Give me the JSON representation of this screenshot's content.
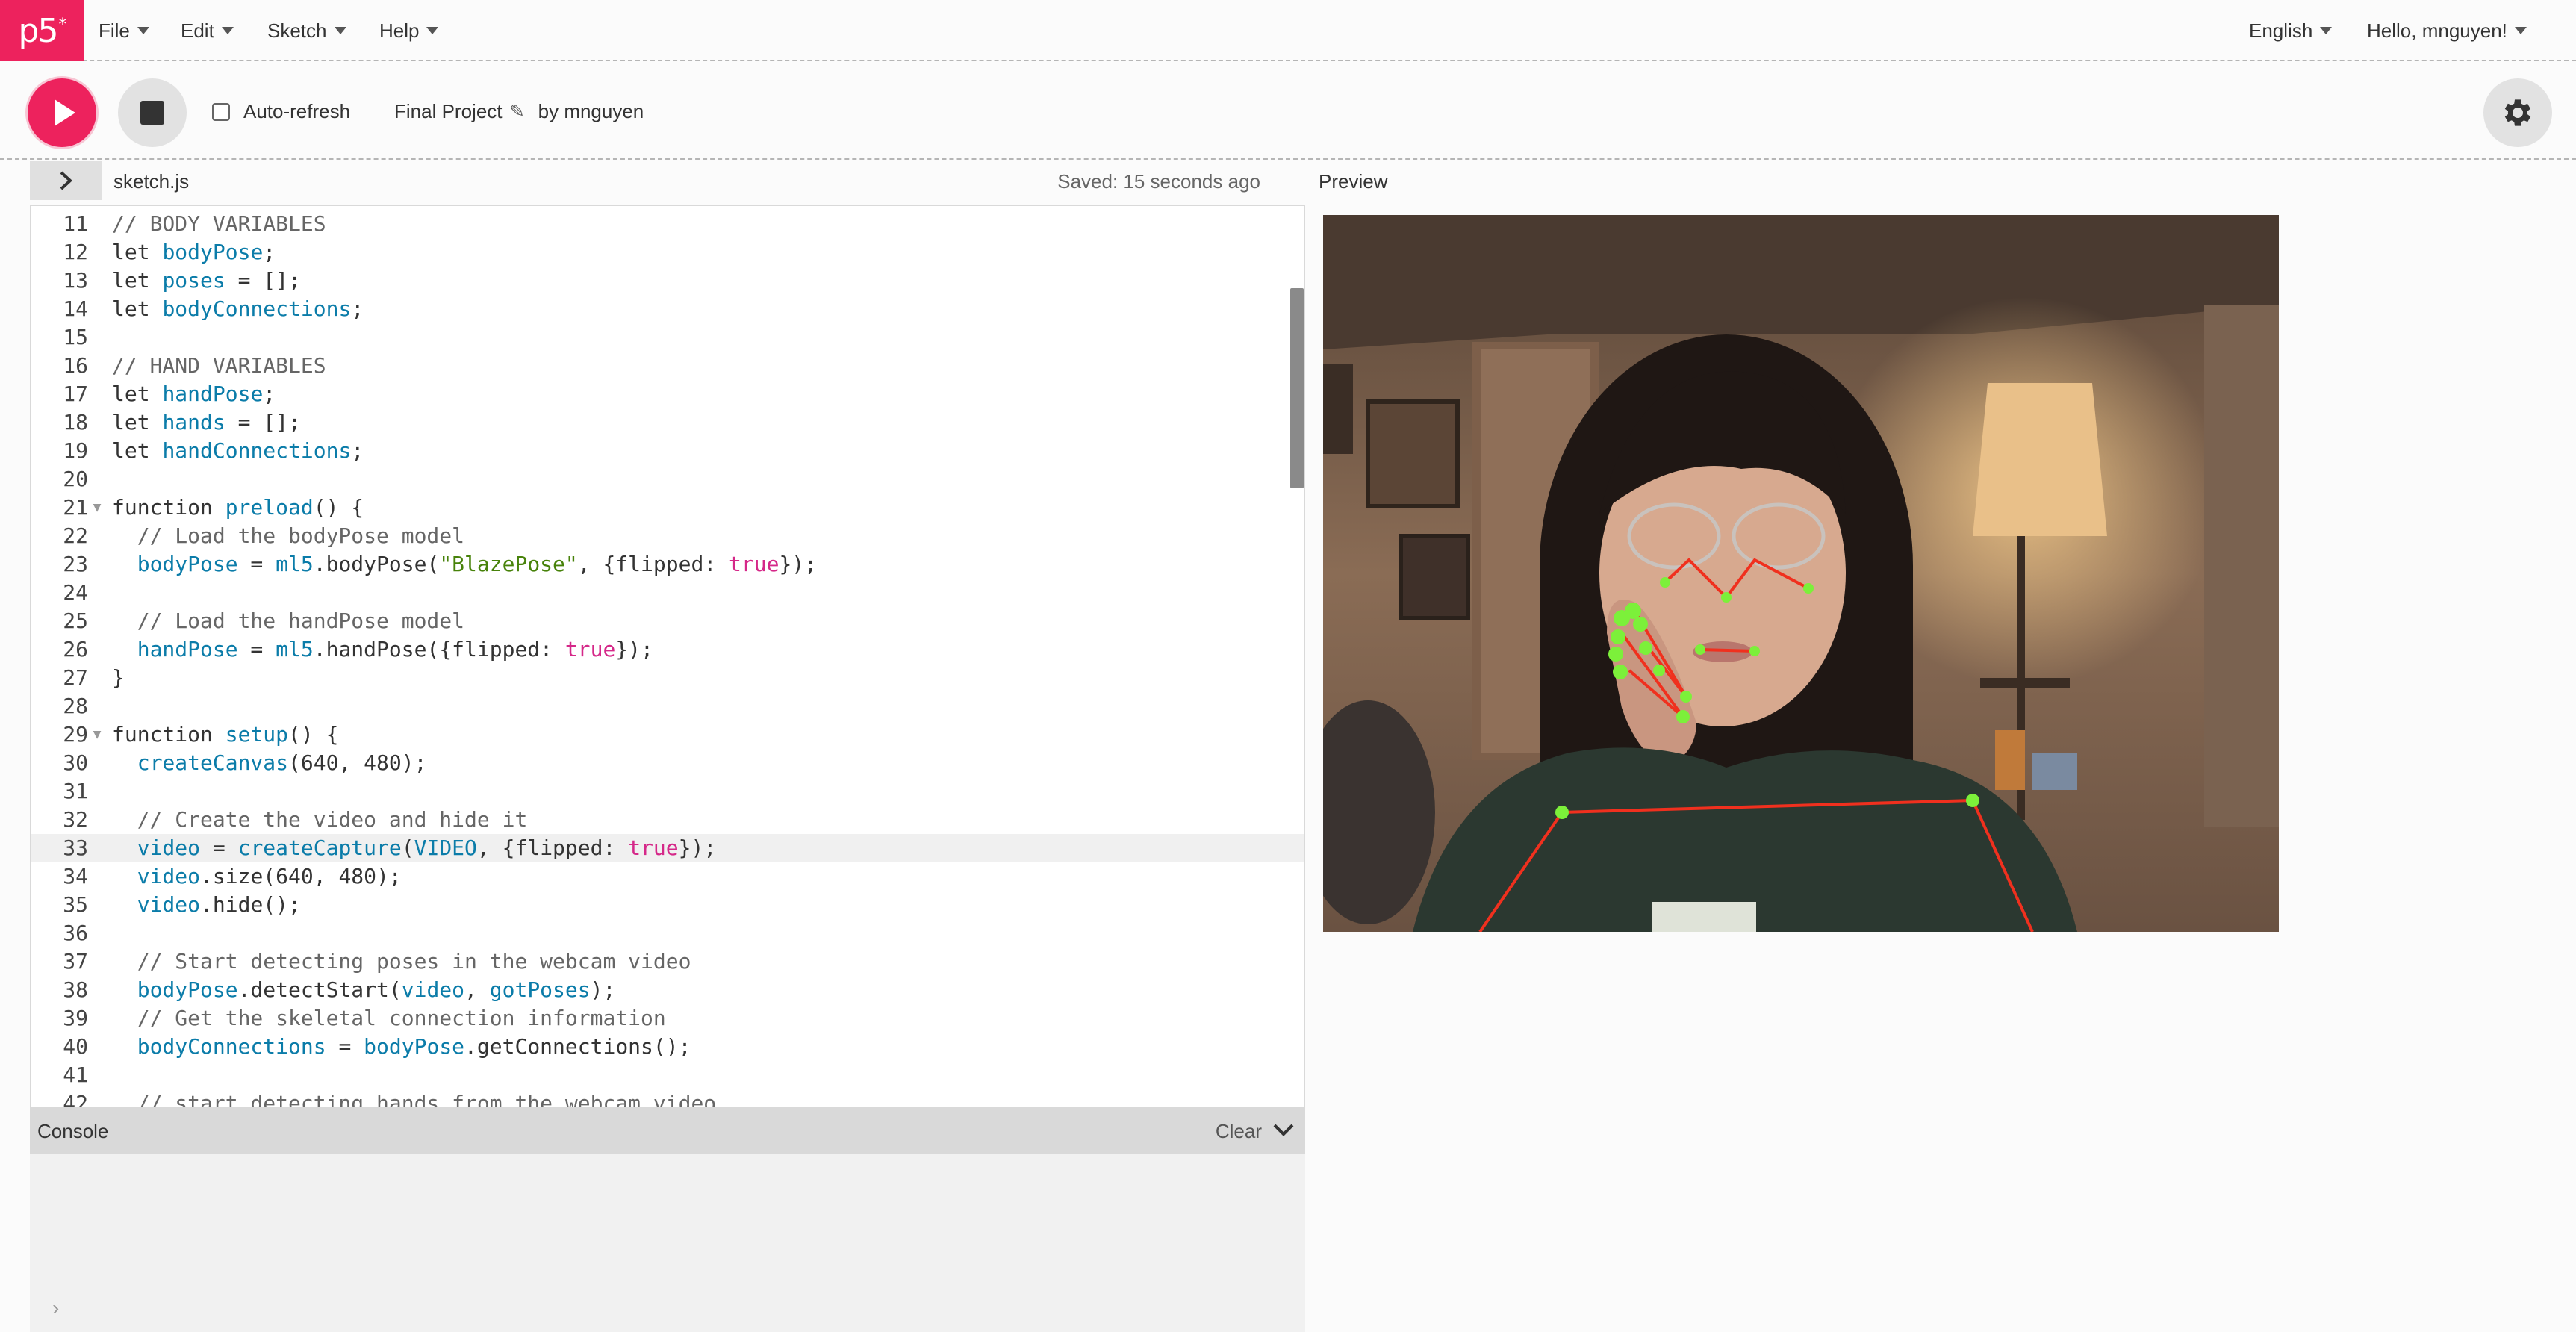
{
  "nav": {
    "logo": "p5",
    "logo_star": "*",
    "menus": [
      "File",
      "Edit",
      "Sketch",
      "Help"
    ],
    "language": "English",
    "user": "Hello, mnguyen!"
  },
  "toolbar": {
    "auto_refresh_label": "Auto-refresh",
    "auto_refresh_checked": false,
    "project_name": "Final Project",
    "by_label": "by",
    "author": "mnguyen"
  },
  "editor": {
    "filename": "sketch.js",
    "saved_status": "Saved: 15 seconds ago",
    "active_line": 33,
    "lines": [
      {
        "n": "11",
        "fold": false,
        "code": [
          {
            "t": "// BODY VARIABLES",
            "c": "cm"
          }
        ]
      },
      {
        "n": "12",
        "fold": false,
        "code": [
          {
            "t": "let ",
            "c": "kw"
          },
          {
            "t": "bodyPose",
            "c": "var"
          },
          {
            "t": ";",
            "c": ""
          }
        ]
      },
      {
        "n": "13",
        "fold": false,
        "code": [
          {
            "t": "let ",
            "c": "kw"
          },
          {
            "t": "poses",
            "c": "var"
          },
          {
            "t": " = [];",
            "c": ""
          }
        ]
      },
      {
        "n": "14",
        "fold": false,
        "code": [
          {
            "t": "let ",
            "c": "kw"
          },
          {
            "t": "bodyConnections",
            "c": "var"
          },
          {
            "t": ";",
            "c": ""
          }
        ]
      },
      {
        "n": "15",
        "fold": false,
        "code": []
      },
      {
        "n": "16",
        "fold": false,
        "code": [
          {
            "t": "// HAND VARIABLES",
            "c": "cm"
          }
        ]
      },
      {
        "n": "17",
        "fold": false,
        "code": [
          {
            "t": "let ",
            "c": "kw"
          },
          {
            "t": "handPose",
            "c": "var"
          },
          {
            "t": ";",
            "c": ""
          }
        ]
      },
      {
        "n": "18",
        "fold": false,
        "code": [
          {
            "t": "let ",
            "c": "kw"
          },
          {
            "t": "hands",
            "c": "var"
          },
          {
            "t": " = [];",
            "c": ""
          }
        ]
      },
      {
        "n": "19",
        "fold": false,
        "code": [
          {
            "t": "let ",
            "c": "kw"
          },
          {
            "t": "handConnections",
            "c": "var"
          },
          {
            "t": ";",
            "c": ""
          }
        ]
      },
      {
        "n": "20",
        "fold": false,
        "code": []
      },
      {
        "n": "21",
        "fold": true,
        "code": [
          {
            "t": "function ",
            "c": "kw"
          },
          {
            "t": "preload",
            "c": "var"
          },
          {
            "t": "() {",
            "c": ""
          }
        ]
      },
      {
        "n": "22",
        "fold": false,
        "code": [
          {
            "t": "  // Load the bodyPose model",
            "c": "cm"
          }
        ]
      },
      {
        "n": "23",
        "fold": false,
        "code": [
          {
            "t": "  ",
            "c": ""
          },
          {
            "t": "bodyPose",
            "c": "var"
          },
          {
            "t": " = ",
            "c": ""
          },
          {
            "t": "ml5",
            "c": "var"
          },
          {
            "t": ".bodyPose(",
            "c": ""
          },
          {
            "t": "\"BlazePose\"",
            "c": "str"
          },
          {
            "t": ", {flipped: ",
            "c": ""
          },
          {
            "t": "true",
            "c": "bool"
          },
          {
            "t": "});",
            "c": ""
          }
        ]
      },
      {
        "n": "24",
        "fold": false,
        "code": []
      },
      {
        "n": "25",
        "fold": false,
        "code": [
          {
            "t": "  // Load the handPose model",
            "c": "cm"
          }
        ]
      },
      {
        "n": "26",
        "fold": false,
        "code": [
          {
            "t": "  ",
            "c": ""
          },
          {
            "t": "handPose",
            "c": "var"
          },
          {
            "t": " = ",
            "c": ""
          },
          {
            "t": "ml5",
            "c": "var"
          },
          {
            "t": ".handPose({flipped: ",
            "c": ""
          },
          {
            "t": "true",
            "c": "bool"
          },
          {
            "t": "});",
            "c": ""
          }
        ]
      },
      {
        "n": "27",
        "fold": false,
        "code": [
          {
            "t": "}",
            "c": ""
          }
        ]
      },
      {
        "n": "28",
        "fold": false,
        "code": []
      },
      {
        "n": "29",
        "fold": true,
        "code": [
          {
            "t": "function ",
            "c": "kw"
          },
          {
            "t": "setup",
            "c": "var"
          },
          {
            "t": "() {",
            "c": ""
          }
        ]
      },
      {
        "n": "30",
        "fold": false,
        "code": [
          {
            "t": "  ",
            "c": ""
          },
          {
            "t": "createCanvas",
            "c": "var"
          },
          {
            "t": "(640, 480);",
            "c": ""
          }
        ]
      },
      {
        "n": "31",
        "fold": false,
        "code": []
      },
      {
        "n": "32",
        "fold": false,
        "code": [
          {
            "t": "  // Create the video and hide it",
            "c": "cm"
          }
        ]
      },
      {
        "n": "33",
        "fold": false,
        "code": [
          {
            "t": "  ",
            "c": ""
          },
          {
            "t": "video",
            "c": "var"
          },
          {
            "t": " = ",
            "c": ""
          },
          {
            "t": "createCapture",
            "c": "var"
          },
          {
            "t": "(",
            "c": ""
          },
          {
            "t": "VIDEO",
            "c": "var"
          },
          {
            "t": ", {flipped: ",
            "c": ""
          },
          {
            "t": "true",
            "c": "bool"
          },
          {
            "t": "});",
            "c": ""
          }
        ]
      },
      {
        "n": "34",
        "fold": false,
        "code": [
          {
            "t": "  ",
            "c": ""
          },
          {
            "t": "video",
            "c": "var"
          },
          {
            "t": ".size(640, 480);",
            "c": ""
          }
        ]
      },
      {
        "n": "35",
        "fold": false,
        "code": [
          {
            "t": "  ",
            "c": ""
          },
          {
            "t": "video",
            "c": "var"
          },
          {
            "t": ".hide();",
            "c": ""
          }
        ]
      },
      {
        "n": "36",
        "fold": false,
        "code": []
      },
      {
        "n": "37",
        "fold": false,
        "code": [
          {
            "t": "  // Start detecting poses in the webcam video",
            "c": "cm"
          }
        ]
      },
      {
        "n": "38",
        "fold": false,
        "code": [
          {
            "t": "  ",
            "c": ""
          },
          {
            "t": "bodyPose",
            "c": "var"
          },
          {
            "t": ".detectStart(",
            "c": ""
          },
          {
            "t": "video",
            "c": "var"
          },
          {
            "t": ", ",
            "c": ""
          },
          {
            "t": "gotPoses",
            "c": "var"
          },
          {
            "t": ");",
            "c": ""
          }
        ]
      },
      {
        "n": "39",
        "fold": false,
        "code": [
          {
            "t": "  // Get the skeletal connection information",
            "c": "cm"
          }
        ]
      },
      {
        "n": "40",
        "fold": false,
        "code": [
          {
            "t": "  ",
            "c": ""
          },
          {
            "t": "bodyConnections",
            "c": "var"
          },
          {
            "t": " = ",
            "c": ""
          },
          {
            "t": "bodyPose",
            "c": "var"
          },
          {
            "t": ".getConnections();",
            "c": ""
          }
        ]
      },
      {
        "n": "41",
        "fold": false,
        "code": []
      },
      {
        "n": "42",
        "fold": false,
        "code": [
          {
            "t": "  // start detecting hands from the webcam video",
            "c": "cm"
          }
        ]
      }
    ]
  },
  "console": {
    "title": "Console",
    "clear_label": "Clear",
    "prompt": "›"
  },
  "preview": {
    "label": "Preview"
  },
  "colors": {
    "brand": "#ed225d",
    "keypoint": "#7cf03a",
    "skeleton": "#f0301e"
  }
}
